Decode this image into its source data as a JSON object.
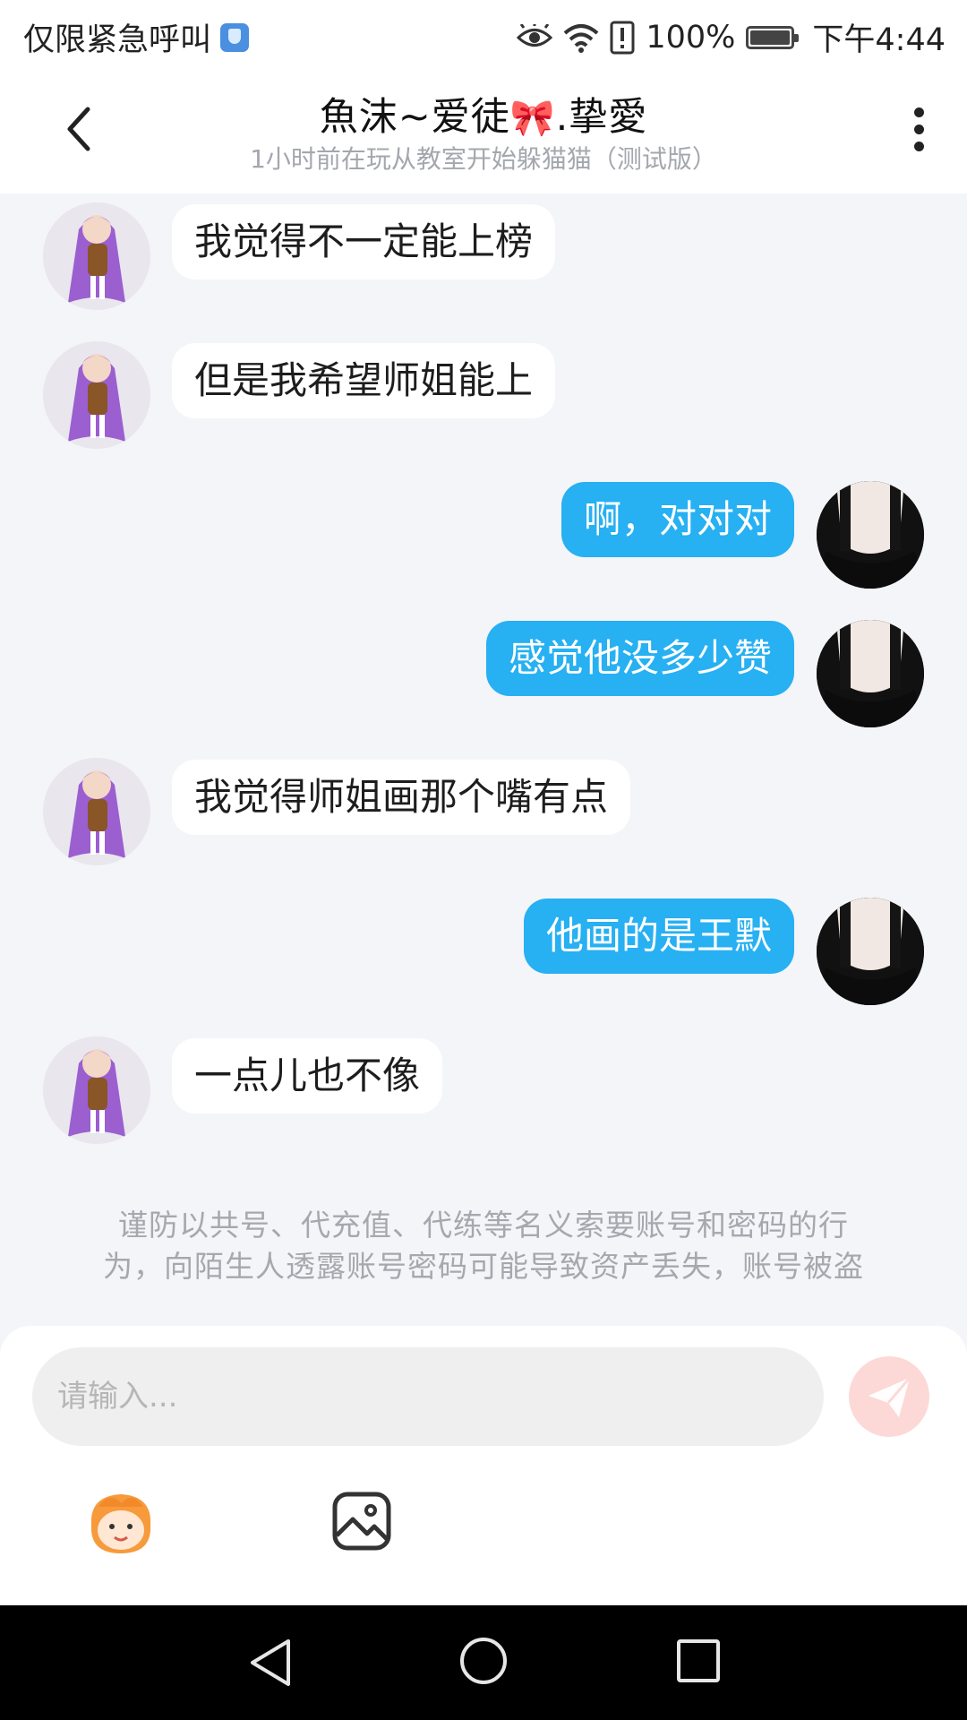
{
  "status_bar": {
    "left_text": "仅限紧急呼叫",
    "battery_text": "100%",
    "time": "下午4:44",
    "icons": [
      "shield-icon",
      "eye-icon",
      "wifi-icon",
      "alert-icon",
      "battery-icon"
    ]
  },
  "header": {
    "title_part1": "魚沫~爱徒",
    "title_part2": ".挚愛",
    "subtitle": "1小时前在玩从教室开始躲猫猫（测试版）",
    "icons": [
      "back-arrow-icon",
      "more-vertical-icon"
    ]
  },
  "messages": [
    {
      "side": "incoming",
      "text": "我觉得不一定能上榜"
    },
    {
      "side": "incoming",
      "text": "但是我希望师姐能上"
    },
    {
      "side": "outgoing",
      "text": "啊，对对对"
    },
    {
      "side": "outgoing",
      "text": "感觉他没多少赞"
    },
    {
      "side": "incoming",
      "text": "我觉得师姐画那个嘴有点"
    },
    {
      "side": "outgoing",
      "text": "他画的是王默"
    },
    {
      "side": "incoming",
      "text": "一点儿也不像"
    }
  ],
  "notice": {
    "line1": "谨防以共号、代充值、代练等名义索要账号和密码的行",
    "line2": "为，向陌生人透露账号密码可能导致资产丢失，账号被盗"
  },
  "composer": {
    "placeholder": "请输入...",
    "icons": [
      "send-icon",
      "emoji-face-icon",
      "image-icon"
    ]
  },
  "colors": {
    "outgoing_bubble": "#27b0f2",
    "incoming_bubble": "#ffffff",
    "background": "#f3f5f8",
    "send_button": "#fcd9d7"
  }
}
